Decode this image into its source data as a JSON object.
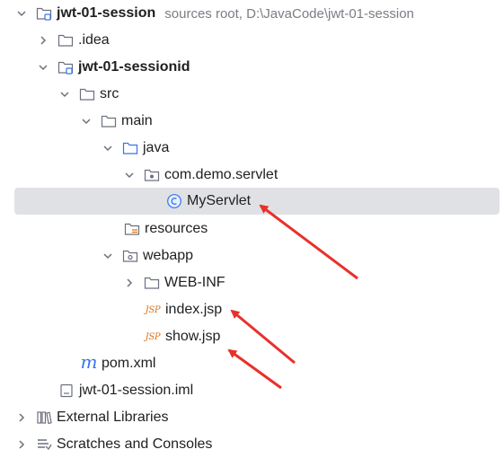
{
  "tree": {
    "rows": [
      {
        "label": "jwt-01-session",
        "hint": "sources root,  D:\\JavaCode\\jwt-01-session",
        "expanded": true,
        "icon": "module-folder-icon"
      },
      {
        "label": ".idea",
        "expanded": false,
        "icon": "folder-icon"
      },
      {
        "label": "jwt-01-sessionid",
        "expanded": true,
        "icon": "module-folder-icon"
      },
      {
        "label": "src",
        "expanded": true,
        "icon": "folder-icon"
      },
      {
        "label": "main",
        "expanded": true,
        "icon": "folder-icon"
      },
      {
        "label": "java",
        "expanded": true,
        "icon": "source-folder-icon"
      },
      {
        "label": "com.demo.servlet",
        "expanded": true,
        "icon": "package-icon"
      },
      {
        "label": "MyServlet",
        "icon": "java-class-icon",
        "icon_text": "C",
        "selected": true
      },
      {
        "label": "resources",
        "icon": "resources-folder-icon"
      },
      {
        "label": "webapp",
        "expanded": true,
        "icon": "web-folder-icon"
      },
      {
        "label": "WEB-INF",
        "expanded": false,
        "icon": "folder-icon"
      },
      {
        "label": "index.jsp",
        "icon": "jsp-file-icon",
        "icon_text": "JSP"
      },
      {
        "label": "show.jsp",
        "icon": "jsp-file-icon",
        "icon_text": "JSP"
      },
      {
        "label": "pom.xml",
        "icon": "maven-icon",
        "icon_text": "m"
      },
      {
        "label": "jwt-01-session.iml",
        "icon": "iml-file-icon"
      },
      {
        "label": "External Libraries",
        "expanded": false,
        "icon": "libraries-icon"
      },
      {
        "label": "Scratches and Consoles",
        "expanded": false,
        "icon": "scratches-icon"
      }
    ]
  },
  "colors": {
    "selection": "#dfe1e5",
    "folder_stroke": "#6c707e",
    "source_folder": "#3574f0",
    "jsp": "#d9731a",
    "maven": "#3574f0",
    "annotation_arrow": "#e8312a"
  }
}
